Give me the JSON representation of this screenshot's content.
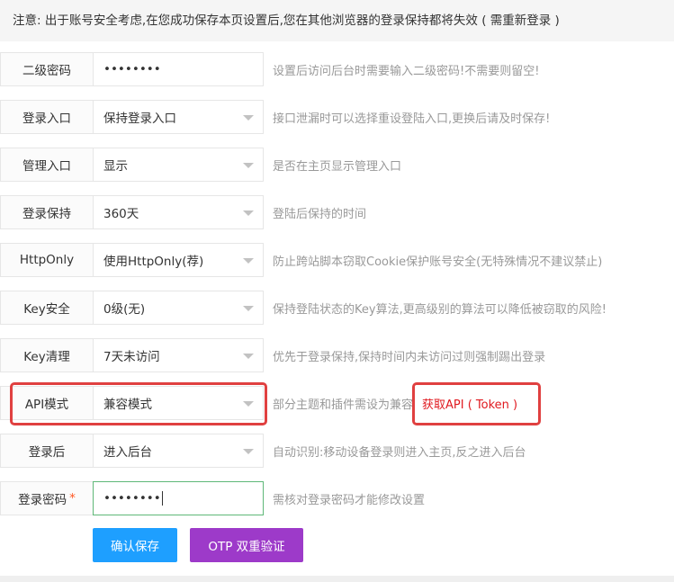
{
  "notice": "注意: 出于账号安全考虑,在您成功保存本页设置后,您在其他浏览器的登录保持都将失效 ( 需重新登录 )",
  "rows": [
    {
      "label": "二级密码",
      "value": "••••••••",
      "hint": "设置后访问后台时需要输入二级密码!不需要则留空!"
    },
    {
      "label": "登录入口",
      "value": "保持登录入口",
      "hint": "接口泄漏时可以选择重设登陆入口,更换后请及时保存!"
    },
    {
      "label": "管理入口",
      "value": "显示",
      "hint": "是否在主页显示管理入口"
    },
    {
      "label": "登录保持",
      "value": "360天",
      "hint": "登陆后保持的时间"
    },
    {
      "label": "HttpOnly",
      "value": "使用HttpOnly(荐)",
      "hint": "防止跨站脚本窃取Cookie保护账号安全(无特殊情况不建议禁止)"
    },
    {
      "label": "Key安全",
      "value": "0级(无)",
      "hint": "保持登陆状态的Key算法,更高级别的算法可以降低被窃取的风险!"
    },
    {
      "label": "Key清理",
      "value": "7天未访问",
      "hint": "优先于登录保持,保持时间内未访问过则强制踢出登录"
    },
    {
      "label": "API模式",
      "value": "兼容模式",
      "hint": "部分主题和插件需设为兼容",
      "link": "获取API ( Token )"
    },
    {
      "label": "登录后",
      "value": "进入后台",
      "hint": "自动识别:移动设备登录则进入主页,反之进入后台"
    },
    {
      "label": "登录密码",
      "required_mark": "*",
      "value": "••••••••",
      "hint": "需核对登录密码才能修改设置"
    }
  ],
  "buttons": {
    "save": "确认保存",
    "otp": "OTP 双重验证"
  },
  "colors": {
    "save_button": "#1E9FFF",
    "otp_button": "#9d3ac9",
    "highlight": "#e04040",
    "focus_border": "#5FB878"
  }
}
